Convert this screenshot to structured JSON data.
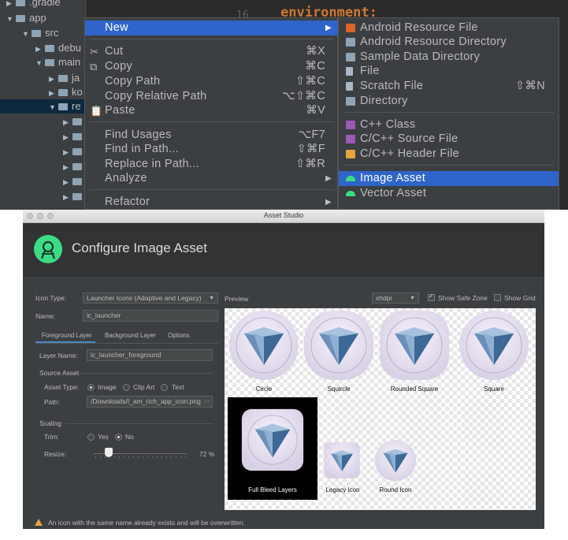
{
  "ide": {
    "tree": [
      {
        "name": ".gradle",
        "expanded": false
      },
      {
        "name": "app",
        "expanded": true
      },
      {
        "name": "src",
        "expanded": true
      },
      {
        "name": "debu",
        "expanded": false
      },
      {
        "name": "main",
        "expanded": true
      },
      {
        "name": "ja",
        "expanded": false
      },
      {
        "name": "ko",
        "expanded": false
      },
      {
        "name": "re",
        "expanded": true
      }
    ],
    "editor_line_number": "16",
    "editor_code": "environment:"
  },
  "context_menu": {
    "items": [
      {
        "label": "New",
        "shortcut": "",
        "has_submenu": true,
        "icon": "",
        "active": true
      },
      {
        "label": "Cut",
        "shortcut": "⌘X",
        "icon": "scissors-icon"
      },
      {
        "label": "Copy",
        "shortcut": "⌘C",
        "icon": "copy-icon"
      },
      {
        "label": "Copy Path",
        "shortcut": "⇧⌘C",
        "icon": ""
      },
      {
        "label": "Copy Relative Path",
        "shortcut": "⌥⇧⌘C",
        "icon": ""
      },
      {
        "label": "Paste",
        "shortcut": "⌘V",
        "icon": "paste-icon"
      },
      {
        "label": "Find Usages",
        "shortcut": "⌥F7",
        "icon": ""
      },
      {
        "label": "Find in Path...",
        "shortcut": "⇧⌘F",
        "icon": ""
      },
      {
        "label": "Replace in Path...",
        "shortcut": "⇧⌘R",
        "icon": ""
      },
      {
        "label": "Analyze",
        "shortcut": "",
        "has_submenu": true,
        "icon": ""
      },
      {
        "label": "Refactor",
        "shortcut": "",
        "has_submenu": true,
        "icon": ""
      }
    ]
  },
  "sub_menu": {
    "items": [
      {
        "label": "Android Resource File",
        "icon": "android-resource-file-icon",
        "color": "#d8662c"
      },
      {
        "label": "Android Resource Directory",
        "icon": "folder-icon",
        "color": "#8fa4b4"
      },
      {
        "label": "Sample Data Directory",
        "icon": "folder-icon",
        "color": "#8fa4b4"
      },
      {
        "label": "File",
        "icon": "file-icon",
        "color": "#a9b7c6"
      },
      {
        "label": "Scratch File",
        "shortcut": "⇧⌘N",
        "icon": "scratch-file-icon",
        "color": "#a9b7c6"
      },
      {
        "label": "Directory",
        "icon": "folder-icon",
        "color": "#8fa4b4"
      },
      {
        "label": "C++ Class",
        "icon": "cpp-class-icon",
        "color": "#9b59b6"
      },
      {
        "label": "C/C++ Source File",
        "icon": "cpp-source-icon",
        "color": "#9b59b6"
      },
      {
        "label": "C/C++ Header File",
        "icon": "cpp-header-icon",
        "color": "#e8a33c"
      },
      {
        "label": "Image Asset",
        "icon": "android-icon",
        "color": "#3ddc84",
        "active": true
      },
      {
        "label": "Vector Asset",
        "icon": "android-icon",
        "color": "#3ddc84"
      }
    ]
  },
  "asset_studio": {
    "window_title": "Asset Studio",
    "header_title": "Configure Image Asset",
    "icon_type_label": "Icon Type:",
    "icon_type_value": "Launcher Icons (Adaptive and Legacy)",
    "name_label": "Name:",
    "name_value": "ic_launcher",
    "tabs": [
      "Foreground Layer",
      "Background Layer",
      "Options"
    ],
    "layer_name_label": "Layer Name:",
    "layer_name_value": "ic_launcher_foreground",
    "source_asset_label": "Source Asset",
    "asset_type_label": "Asset Type:",
    "asset_type_options": [
      "Image",
      "Clip Art",
      "Text"
    ],
    "asset_type_selected": "Image",
    "path_label": "Path:",
    "path_value": "/Downloads/I_am_rich_app_icon.png",
    "scaling_label": "Scaling",
    "trim_label": "Trim:",
    "trim_options": [
      "Yes",
      "No"
    ],
    "trim_selected": "No",
    "resize_label": "Resize:",
    "resize_value": "72 %",
    "resize_percent": 72,
    "preview_label": "Preview",
    "density_value": "xhdpi",
    "show_safe_zone_label": "Show Safe Zone",
    "show_safe_zone_checked": true,
    "show_grid_label": "Show Grid",
    "show_grid_checked": false,
    "preview_labels": [
      "Circle",
      "Squircle",
      "Rounded Square",
      "Square",
      "Full Bleed Layers",
      "Legacy Icon",
      "Round Icon"
    ],
    "warning": "An icon with the same name already exists and will be overwritten."
  }
}
